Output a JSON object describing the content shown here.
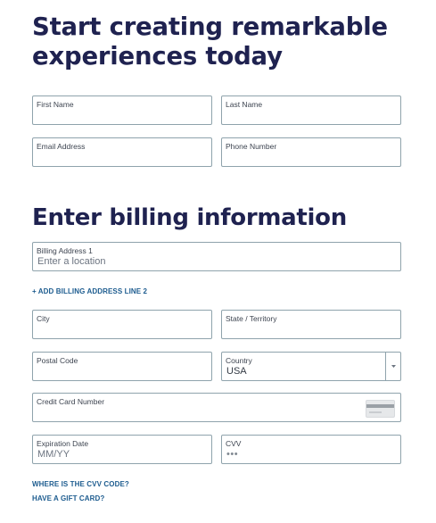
{
  "headings": {
    "main": "Start creating remarkable experiences today",
    "billing": "Enter billing information"
  },
  "fields": {
    "first_name": {
      "label": "First Name",
      "value": ""
    },
    "last_name": {
      "label": "Last Name",
      "value": ""
    },
    "email": {
      "label": "Email Address",
      "value": ""
    },
    "phone": {
      "label": "Phone Number",
      "value": ""
    },
    "billing_address_1": {
      "label": "Billing Address 1",
      "placeholder": "Enter a location"
    },
    "city": {
      "label": "City",
      "value": ""
    },
    "state": {
      "label": "State / Territory",
      "value": ""
    },
    "postal_code": {
      "label": "Postal Code",
      "value": ""
    },
    "country": {
      "label": "Country",
      "value": "USA"
    },
    "credit_card": {
      "label": "Credit Card Number",
      "value": ""
    },
    "expiration": {
      "label": "Expiration Date",
      "placeholder": "MM/YY"
    },
    "cvv": {
      "label": "CVV",
      "placeholder": "•••"
    }
  },
  "links": {
    "add_billing_line2": "+ ADD BILLING ADDRESS LINE 2",
    "cvv_help": "WHERE IS THE CVV CODE?",
    "gift_card": "HAVE A GIFT CARD?"
  },
  "icons": {
    "credit_card": "credit-card-icon",
    "chevron": "chevron-down-icon"
  },
  "colors": {
    "heading": "#1f2250",
    "link": "#1d5c8f",
    "border": "#8fa3ac"
  }
}
